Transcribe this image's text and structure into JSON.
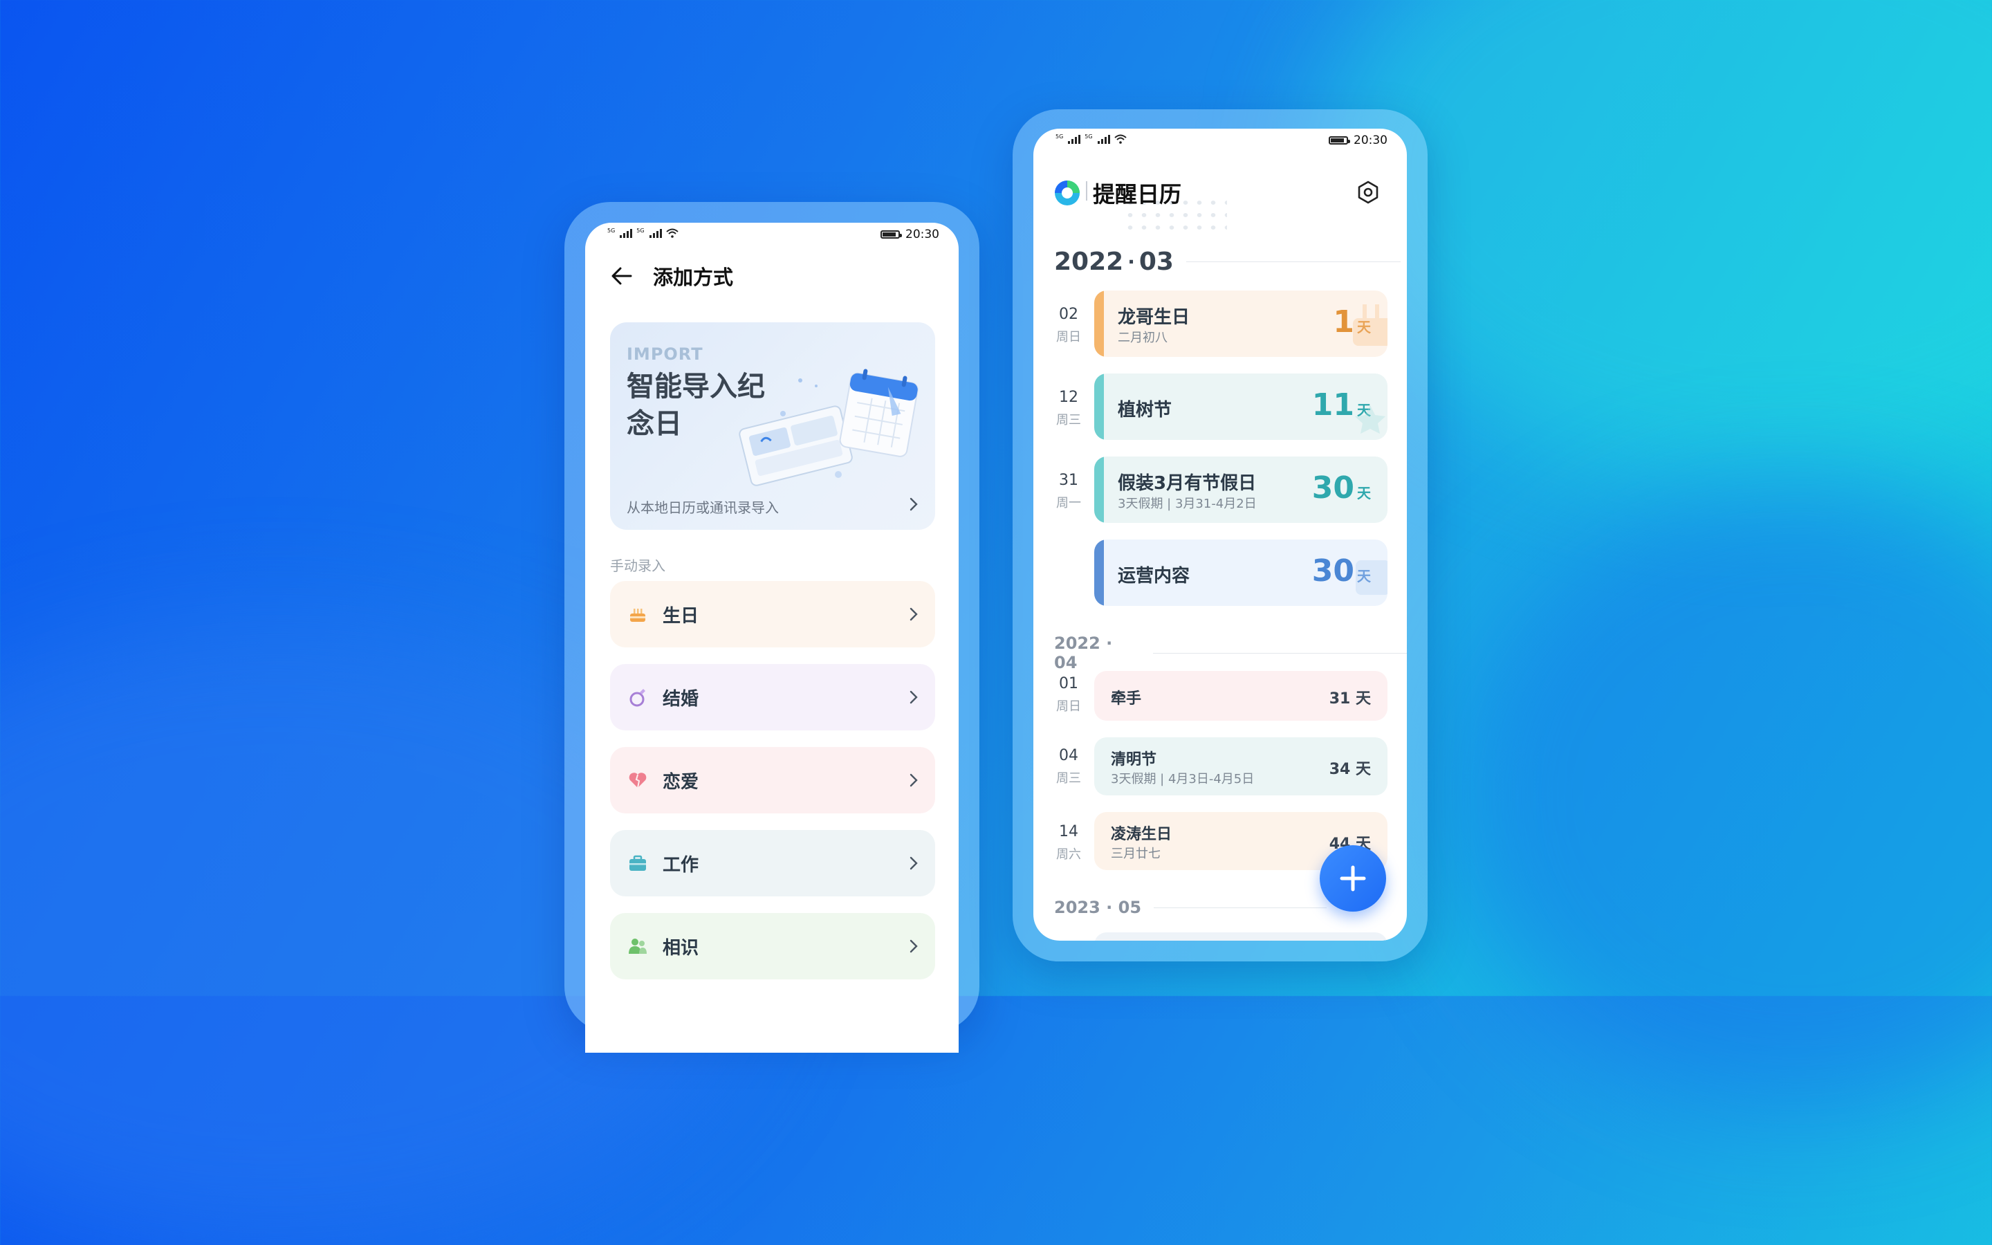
{
  "status_bar": {
    "time": "20:30",
    "signal_tag": "5G"
  },
  "left_screen": {
    "title": "添加方式",
    "import_card": {
      "tag": "IMPORT",
      "title": "智能导入纪念日",
      "subtitle": "从本地日历或通讯录导入"
    },
    "manual_label": "手动录入",
    "categories": [
      {
        "label": "生日",
        "icon": "cake-icon",
        "color": "#fdf5ee",
        "accent": "#f3a54a"
      },
      {
        "label": "结婚",
        "icon": "ring-icon",
        "color": "#f6f1fb",
        "accent": "#a77fd6"
      },
      {
        "label": "恋爱",
        "icon": "heart-icon",
        "color": "#fdf0f1",
        "accent": "#ef7f8f"
      },
      {
        "label": "工作",
        "icon": "briefcase-icon",
        "color": "#eef4f6",
        "accent": "#4ab3c4"
      },
      {
        "label": "相识",
        "icon": "people-icon",
        "color": "#eff8ee",
        "accent": "#6ec16b"
      }
    ]
  },
  "right_screen": {
    "app_title": "提醒日历",
    "month_1": {
      "year": "2022",
      "sep": "·",
      "month": "03"
    },
    "events_march": [
      {
        "day": "02",
        "weekday": "周日",
        "title": "龙哥生日",
        "sub": "二月初八",
        "count": "1",
        "unit": "天",
        "bar": "#f5b56b",
        "bg": "#fdf3ea",
        "num_color": "#e2933a"
      },
      {
        "day": "12",
        "weekday": "周三",
        "title": "植树节",
        "sub": "",
        "count": "11",
        "unit": "天",
        "bar": "#6fcfcf",
        "bg": "#ebf5f5",
        "num_color": "#2fa8ad"
      },
      {
        "day": "31",
        "weekday": "周一",
        "title": "假装3月有节假日",
        "sub": "3天假期 | 3月31-4月2日",
        "count": "30",
        "unit": "天",
        "bar": "#6fcfcf",
        "bg": "#ebf5f5",
        "num_color": "#2fa8ad"
      },
      {
        "day": "",
        "weekday": "",
        "title": "运营内容",
        "sub": "",
        "count": "30",
        "unit": "天",
        "bar": "#5b8fd6",
        "bg": "#edf4fd",
        "num_color": "#4a86d4"
      }
    ],
    "month_2": "2022 · 04",
    "events_april": [
      {
        "day": "01",
        "weekday": "周日",
        "title": "牵手",
        "sub": "",
        "count": "31 天",
        "bg": "#fdf0f1"
      },
      {
        "day": "04",
        "weekday": "周三",
        "title": "清明节",
        "sub": "3天假期 | 4月3日-4月5日",
        "count": "34 天",
        "bg": "#ebf5f5"
      },
      {
        "day": "14",
        "weekday": "周六",
        "title": "凌涛生日",
        "sub": "三月廿七",
        "count": "44 天",
        "bg": "#fdf3ea"
      }
    ],
    "month_3": "2023 · 05"
  }
}
